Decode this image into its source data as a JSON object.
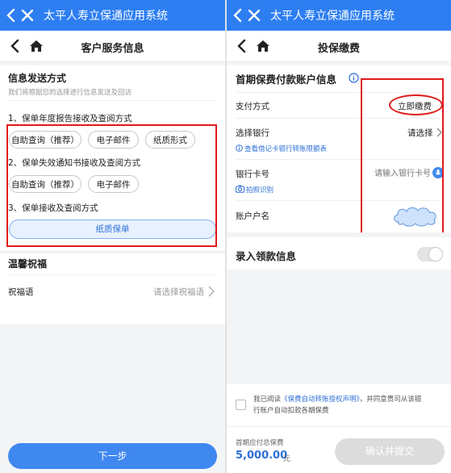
{
  "left": {
    "app_title": "太平人寿立保通应用系统",
    "page_title": "客户服务信息",
    "section1": {
      "title": "信息发送方式",
      "subtitle": "我们将根据您的选择进行信息发送及回访",
      "q1": {
        "label": "1、保单年度报告接收及查阅方式",
        "options": [
          "自助查询（推荐）",
          "电子邮件",
          "纸质形式"
        ]
      },
      "q2": {
        "label": "2、保单失效通知书接收及查阅方式",
        "options": [
          "自助查询（推荐）",
          "电子邮件"
        ]
      },
      "q3": {
        "label": "3、保单接收及查阅方式",
        "selected": "纸质保单"
      }
    },
    "section2": {
      "title": "温馨祝福",
      "greeting_label": "祝福语",
      "greeting_placeholder": "请选择祝福语"
    },
    "next_button": "下一步"
  },
  "right": {
    "app_title": "太平人寿立保通应用系统",
    "page_title": "投保缴费",
    "account_section": {
      "title": "首期保费付款账户信息",
      "payment_method_label": "支付方式",
      "payment_method_value": "立即缴费",
      "bank_label": "选择银行",
      "bank_value": "请选择",
      "bank_link": "查看借记卡银行转账限额表",
      "card_label": "银行卡号",
      "card_placeholder": "请输入银行卡号",
      "photo_link": "拍照识别",
      "account_name_label": "账户户名"
    },
    "payee_section": {
      "title": "录入领款信息"
    },
    "agreement": {
      "prefix": "我已阅读",
      "link": "《保费自动转账授权声明》",
      "suffix_line1": "，并同意贵司从该银",
      "line2": "行账户自动扣款各期保费"
    },
    "total_label": "首期应付总保费",
    "total_amount": "5,000.00",
    "total_unit": "元",
    "submit_button": "确认并提交"
  },
  "colors": {
    "brand_blue": "#2d7ef1",
    "highlight_red": "#e01a1a",
    "link_blue": "#2d6fd8"
  }
}
